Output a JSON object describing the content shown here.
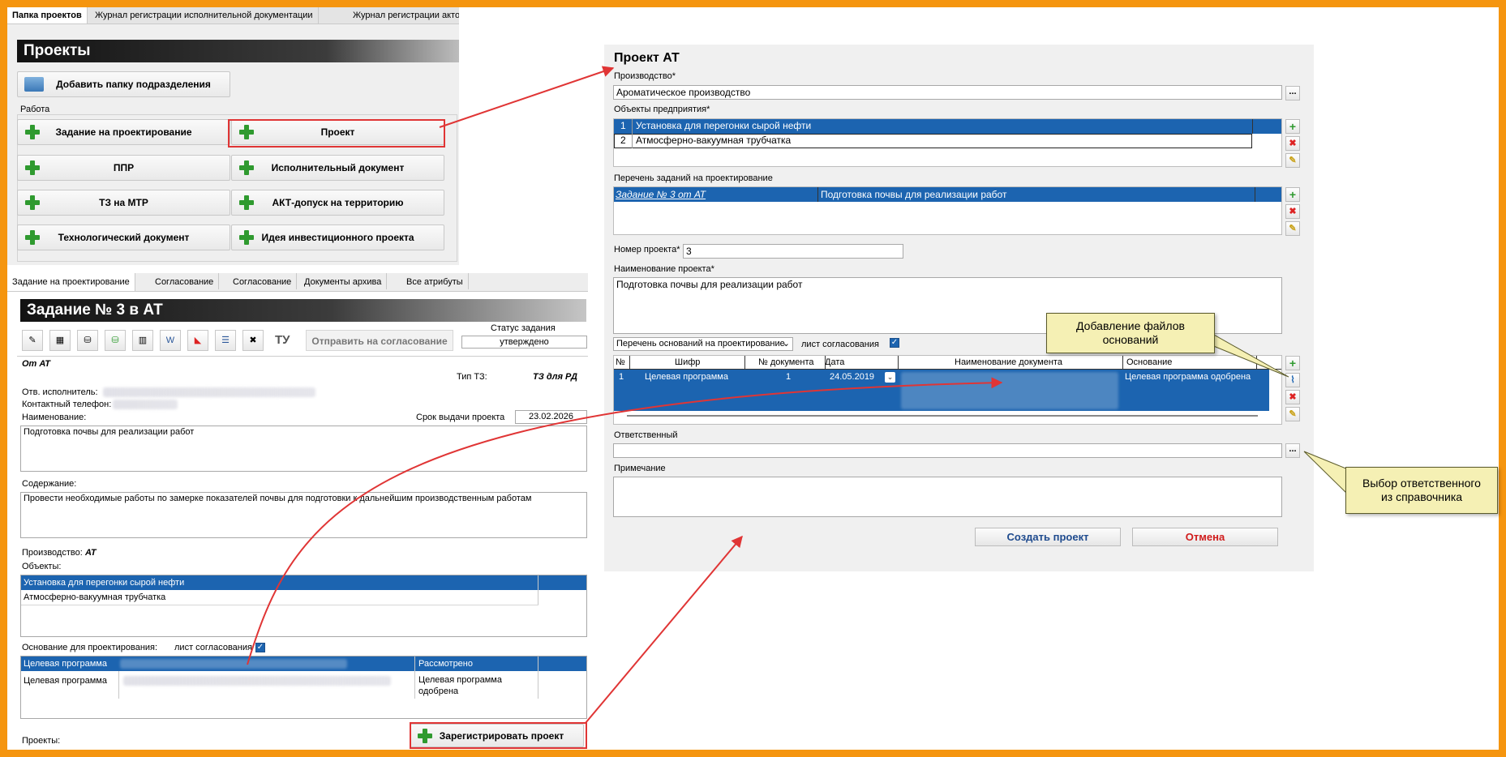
{
  "tabs_top": [
    "Папка проектов",
    "Журнал регистрации исполнительной документации",
    "Журнал регистрации акто"
  ],
  "projects": {
    "title": "Проекты",
    "add_folder": "Добавить папку подразделения",
    "group_label": "Работа",
    "buttons": [
      "Задание на проектирование",
      "Проект",
      "ППР",
      "Исполнительный документ",
      "ТЗ на МТР",
      "АКТ-допуск на территорию",
      "Технологический документ",
      "Идея инвестиционного проекта"
    ]
  },
  "task_tabs": [
    "Задание на проектирование",
    "Согласование",
    "Согласование",
    "Документы архива",
    "Все атрибуты"
  ],
  "task": {
    "title": "Задание № 3 в АТ",
    "send_button": "Отправить на согласование",
    "tu_label": "ТУ",
    "status_label": "Статус задания",
    "status_value": "утверждено",
    "from": "От АТ",
    "tz_type_label": "Тип ТЗ:",
    "tz_type_value": "ТЗ для РД",
    "executor_label": "Отв. исполнитель:",
    "phone_label": "Контактный телефон:",
    "name_label": "Наименование:",
    "deadline_label": "Срок выдачи проекта",
    "deadline_value": "23.02.2026",
    "name_value": "Подготовка почвы для реализации работ",
    "content_label": "Содержание:",
    "content_value": "Провести необходимые работы по замерке показателей почвы для подготовки к дальнейшим производственным работам",
    "production_label": "Производство:",
    "production_value": "АТ",
    "objects_label": "Объекты:",
    "objects": [
      "Установка для перегонки сырой нефти",
      "Атмосферно-вакуумная трубчатка"
    ],
    "basis_label": "Основание для проектирования:",
    "approval_sheet": "лист согласования",
    "basis_rows": [
      {
        "program": "Целевая программа",
        "status": "Рассмотрено"
      },
      {
        "program": "Целевая программа",
        "status": "Целевая программа одобрена"
      }
    ],
    "register_button": "Зарегистрировать проект",
    "projects_label": "Проекты:"
  },
  "form": {
    "title": "Проект АТ",
    "production_label": "Производство*",
    "production_value": "Ароматическое производство",
    "objects_label": "Объекты предприятия*",
    "objects": [
      {
        "n": "1",
        "name": "Установка для перегонки сырой нефти"
      },
      {
        "n": "2",
        "name": "Атмосферно-вакуумная трубчатка"
      }
    ],
    "tasks_label": "Перечень заданий на проектирование",
    "task_link": "Задание № 3 от АТ",
    "task_name": "Подготовка почвы для реализации работ",
    "number_label": "Номер проекта*",
    "number_value": "3",
    "name_label": "Наименование проекта*",
    "name_value": "Подготовка почвы для реализации работ",
    "basis_select": "Перечень оснований на проектирование",
    "approval_sheet": "лист согласования",
    "grid_headers": [
      "№",
      "Шифр",
      "№ документа",
      "Дата",
      "Наименование документа",
      "Основание"
    ],
    "grid_row": {
      "n": "1",
      "code": "Целевая программа",
      "doc_no": "1",
      "date": "24.05.2019",
      "basis": "Целевая программа одобрена"
    },
    "responsible_label": "Ответственный",
    "note_label": "Примечание",
    "create_button": "Создать проект",
    "cancel_button": "Отмена",
    "ellipsis": "..."
  },
  "callouts": {
    "files": "Добавление файлов оснований",
    "responsible": "Выбор ответственного из справочника"
  },
  "colors": {
    "frame": "#f5950f",
    "selection": "#1c64b0",
    "arrow": "#e03535",
    "callout": "#f5f0b4"
  }
}
